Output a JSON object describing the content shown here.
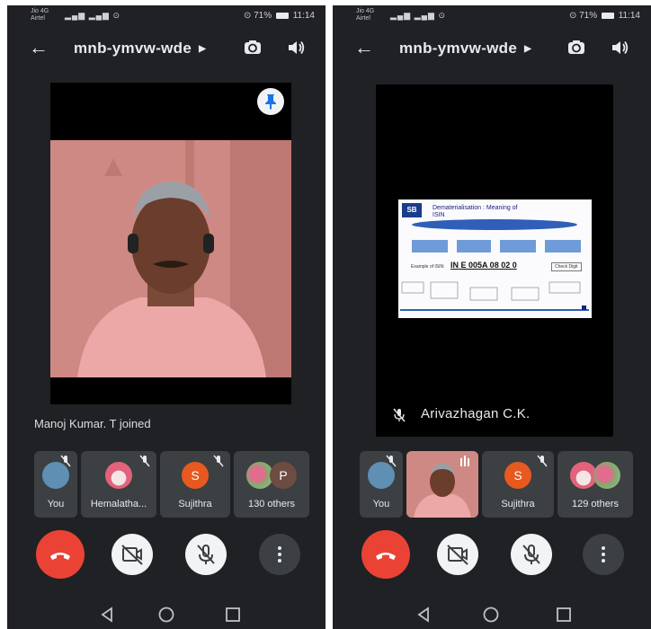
{
  "left": {
    "status": {
      "carrier_line1": "Jio 4G",
      "carrier_line2": "Airtel",
      "battery_pct": "71%",
      "time": "11:14"
    },
    "meeting_code": "mnb-ymvw-wde",
    "join_notice": "Manoj Kumar. T joined",
    "participants": [
      {
        "label": "You"
      },
      {
        "label": "Hemalatha..."
      },
      {
        "label": "Sujithra",
        "initial": "S"
      },
      {
        "label": "130 others",
        "initial": "P"
      }
    ]
  },
  "right": {
    "status": {
      "carrier_line1": "Jio 4G",
      "carrier_line2": "Airtel",
      "battery_pct": "71%",
      "time": "11:14"
    },
    "meeting_code": "mnb-ymvw-wde",
    "presenter_name": "Arivazhagan C.K.",
    "slide": {
      "title_line1": "Dematerialisation : Meaning of",
      "title_line2": "ISIN",
      "isin_label": "Example of ISIN:",
      "isin_value": "IN E 005A 08 02 0",
      "check_digit": "Check Digit"
    },
    "participants": [
      {
        "label": "You"
      },
      {
        "label": "Sujithra",
        "initial": "S"
      },
      {
        "label": "129 others"
      }
    ]
  },
  "icons": [
    "back-arrow-icon",
    "caret-right-icon",
    "camera-switch-icon",
    "speaker-icon",
    "pin-icon",
    "mic-off-icon",
    "hang-up-icon",
    "camera-off-icon",
    "more-vert-icon",
    "nav-back-icon",
    "nav-home-icon",
    "nav-recents-icon"
  ],
  "colors": {
    "background": "#202124",
    "tile": "#3c4043",
    "hangup": "#ea4335",
    "accent_orange": "#e8591f"
  }
}
